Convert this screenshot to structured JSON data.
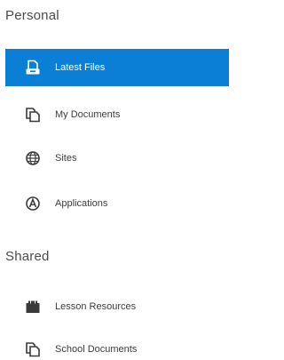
{
  "sections": {
    "personal": {
      "heading": "Personal",
      "items": [
        {
          "label": "Latest Files",
          "icon": "latest-files-icon",
          "active": true
        },
        {
          "label": "My Documents",
          "icon": "documents-icon",
          "active": false
        },
        {
          "label": "Sites",
          "icon": "globe-icon",
          "active": false
        },
        {
          "label": "Applications",
          "icon": "applications-icon",
          "active": false
        }
      ]
    },
    "shared": {
      "heading": "Shared",
      "items": [
        {
          "label": "Lesson Resources",
          "icon": "lesson-resources-icon",
          "active": false
        },
        {
          "label": "School Documents",
          "icon": "documents-icon",
          "active": false
        }
      ]
    }
  },
  "colors": {
    "active_background": "#0b7ed6",
    "active_text": "#ffffff",
    "text": "#3c3c3c"
  }
}
